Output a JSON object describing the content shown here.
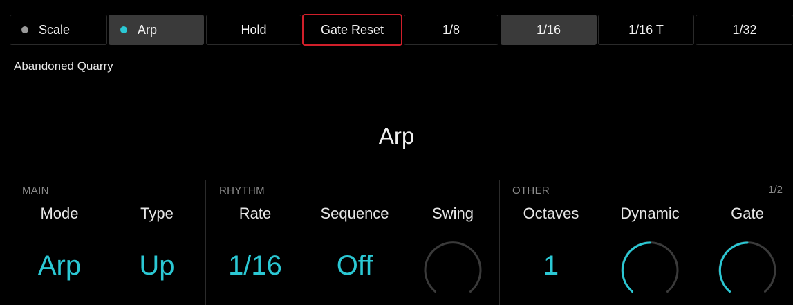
{
  "tabs": [
    {
      "label": "Scale",
      "dot_color": "#9a9a9a",
      "active": false
    },
    {
      "label": "Arp",
      "dot_color": "#2bc8d4",
      "active": true
    },
    {
      "label": "Hold",
      "active": false
    },
    {
      "label": "Gate Reset",
      "active": false,
      "highlighted": true
    },
    {
      "label": "1/8",
      "active": false
    },
    {
      "label": "1/16",
      "active": true
    },
    {
      "label": "1/16 T",
      "active": false
    },
    {
      "label": "1/32",
      "active": false
    }
  ],
  "preset_name": "Abandoned Quarry",
  "page_title": "Arp",
  "page_indicator": "1/2",
  "sections": {
    "main": "MAIN",
    "rhythm": "RHYTHM",
    "other": "OTHER"
  },
  "params": [
    {
      "label": "Mode",
      "value": "Arp"
    },
    {
      "label": "Type",
      "value": "Up"
    },
    {
      "label": "Rate",
      "value": "1/16"
    },
    {
      "label": "Sequence",
      "value": "Off"
    },
    {
      "label": "Swing",
      "knob_level": 0.0
    },
    {
      "label": "Octaves",
      "value": "1"
    },
    {
      "label": "Dynamic",
      "knob_level": 0.5
    },
    {
      "label": "Gate",
      "knob_level": 0.5
    }
  ],
  "colors": {
    "accent": "#2bc8d4",
    "track": "#3a3a3a",
    "highlight_border": "#d01f2a"
  }
}
